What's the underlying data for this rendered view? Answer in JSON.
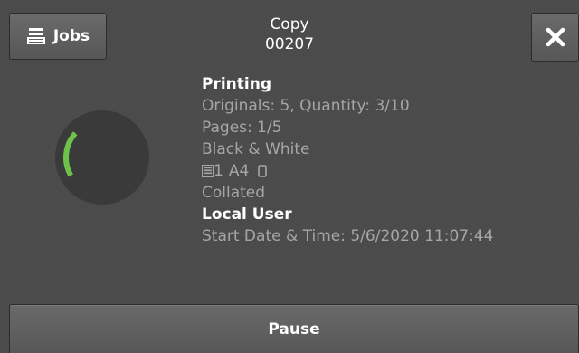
{
  "header": {
    "jobs_label": "Jobs",
    "job_type": "Copy",
    "job_number": "00207"
  },
  "job": {
    "status": "Printing",
    "originals_quantity": "Originals: 5, Quantity: 3/10",
    "pages": "Pages: 1/5",
    "color_mode": "Black & White",
    "tray": "1",
    "paper_size": "A4",
    "collation": "Collated",
    "user": "Local User",
    "start_time": "Start Date & Time: 5/6/2020 11:07:44"
  },
  "progress": {
    "fraction": 0.2,
    "color": "#6cc24a",
    "track_color": "#3a3a3a"
  },
  "footer": {
    "pause_label": "Pause"
  },
  "icons": {
    "jobs": "job-stack-icon",
    "close": "close-icon",
    "tray": "paper-tray-icon",
    "orientation": "portrait-orientation-icon"
  },
  "colors": {
    "background": "#4a4a4a",
    "text_primary": "#ffffff",
    "text_secondary": "#a6a6a6"
  }
}
